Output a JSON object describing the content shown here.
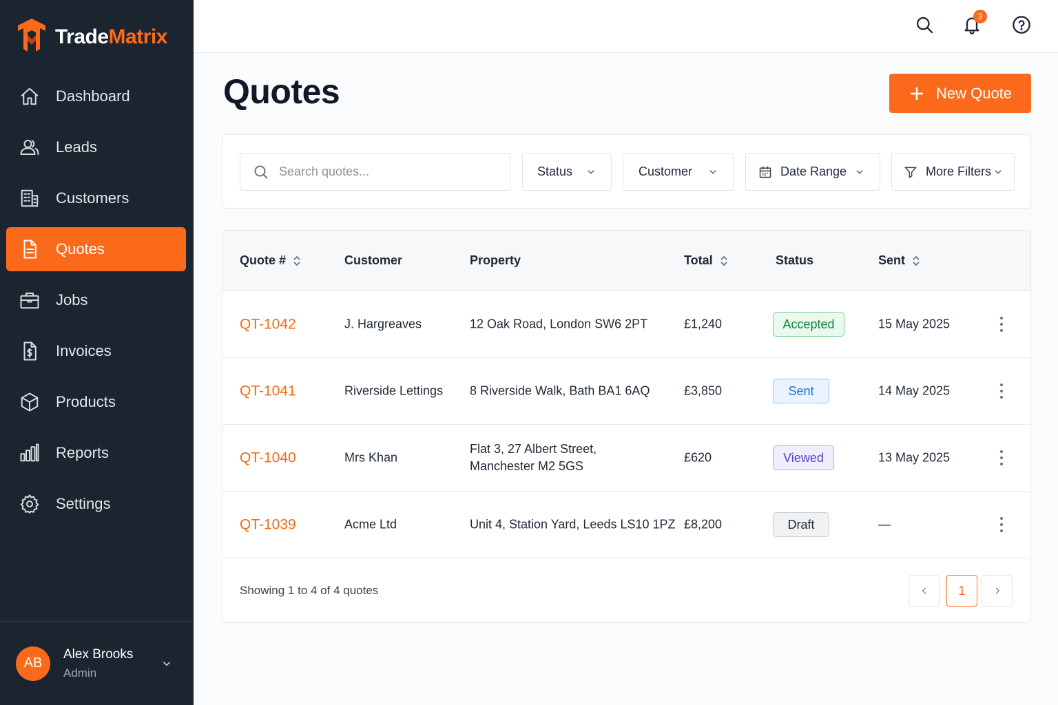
{
  "brand": {
    "name_part1": "Trade",
    "name_part2": "Matrix",
    "accent": "#fb6a1b"
  },
  "sidebar": {
    "items": [
      {
        "label": "Dashboard",
        "icon": "home-icon"
      },
      {
        "label": "Leads",
        "icon": "users-icon"
      },
      {
        "label": "Customers",
        "icon": "building-icon"
      },
      {
        "label": "Quotes",
        "icon": "document-icon",
        "active": true
      },
      {
        "label": "Jobs",
        "icon": "briefcase-icon"
      },
      {
        "label": "Invoices",
        "icon": "invoice-icon"
      },
      {
        "label": "Products",
        "icon": "box-icon"
      },
      {
        "label": "Reports",
        "icon": "bar-chart-icon"
      },
      {
        "label": "Settings",
        "icon": "gear-icon"
      }
    ]
  },
  "user": {
    "initials": "AB",
    "name": "Alex Brooks",
    "role": "Admin"
  },
  "topbar": {
    "notification_count": "3"
  },
  "page": {
    "title": "Quotes",
    "new_button_label": "New Quote"
  },
  "filters": {
    "search_placeholder": "Search quotes...",
    "status_label": "Status",
    "customer_label": "Customer",
    "date_range_label": "Date Range",
    "more_filters_label": "More Filters"
  },
  "table": {
    "headers": {
      "quote": "Quote #",
      "customer": "Customer",
      "property": "Property",
      "total": "Total",
      "status": "Status",
      "sent": "Sent"
    },
    "rows": [
      {
        "id": "QT-1042",
        "customer": "J. Hargreaves",
        "property": "12 Oak Road, London SW6 2PT",
        "total": "£1,240",
        "status": "Accepted",
        "sent": "15 May 2025"
      },
      {
        "id": "QT-1041",
        "customer": "Riverside Lettings",
        "property": "8 Riverside Walk, Bath BA1 6AQ",
        "total": "£3,850",
        "status": "Sent",
        "sent": "14 May 2025"
      },
      {
        "id": "QT-1040",
        "customer": "Mrs Khan",
        "property_line1": "Flat 3, 27 Albert Street,",
        "property_line2": "Manchester M2 5GS",
        "total": "£620",
        "status": "Viewed",
        "sent": "13 May 2025"
      },
      {
        "id": "QT-1039",
        "customer": "Acme Ltd",
        "property": "Unit 4, Station Yard, Leeds LS10 1PZ",
        "total": "£8,200",
        "status": "Draft",
        "sent": "—"
      }
    ],
    "status_colors": {
      "Accepted": {
        "bg": "#e9f9ee",
        "border": "#7fd49a",
        "text": "#15803d"
      },
      "Sent": {
        "bg": "#eaf3fe",
        "border": "#93c5fd",
        "text": "#1d6fd8"
      },
      "Viewed": {
        "bg": "#efedfe",
        "border": "#b4a9f5",
        "text": "#4c3fc7"
      },
      "Draft": {
        "bg": "#f1f2f4",
        "border": "#c9cdd3",
        "text": "#1f2937"
      }
    }
  },
  "pagination": {
    "summary": "Showing 1 to 4 of 4 quotes",
    "current_page": "1"
  }
}
